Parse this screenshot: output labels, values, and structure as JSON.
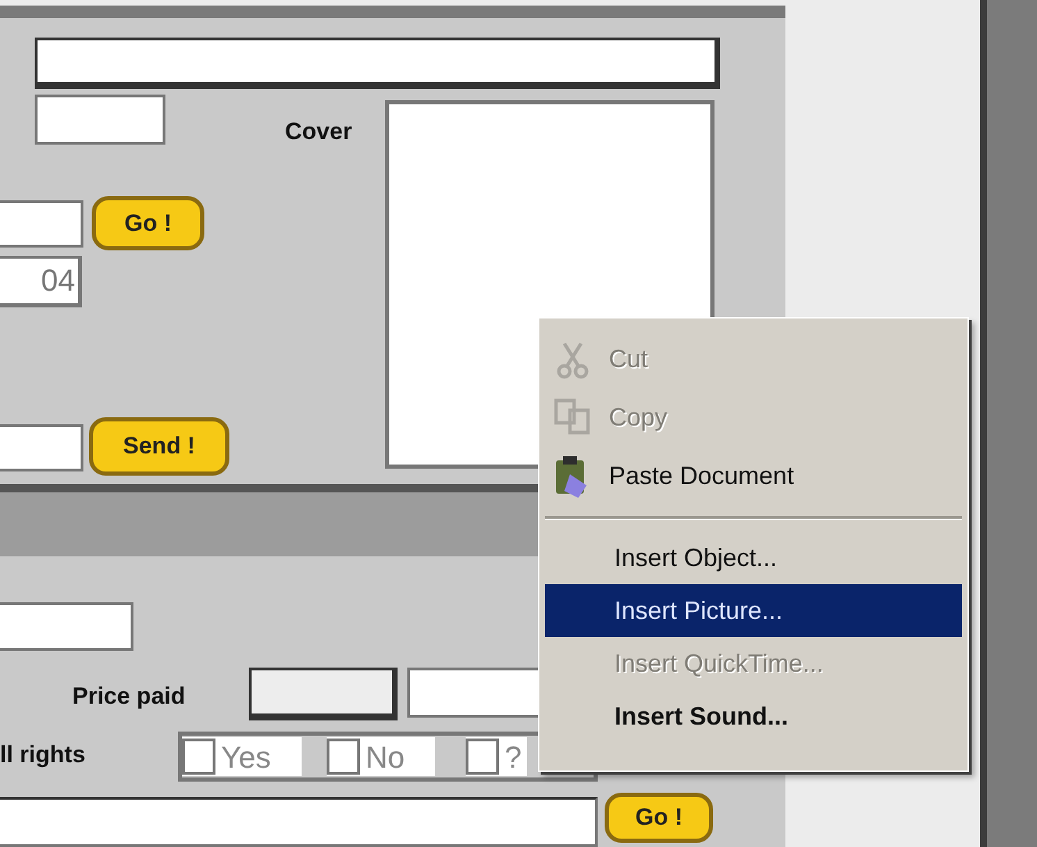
{
  "top_form": {
    "cover_label": "Cover",
    "go_button": "Go !",
    "number_field": {
      "value": "04"
    },
    "send_button": "Send !"
  },
  "bottom_form": {
    "price_label": "Price paid",
    "rights_label": "ll rights",
    "rights_options": [
      {
        "label": "Yes",
        "checked": false
      },
      {
        "label": "No",
        "checked": false
      },
      {
        "label": "?",
        "checked": false
      }
    ],
    "go_button": "Go !"
  },
  "context_menu": {
    "items": [
      {
        "kind": "icon_item",
        "label": "Cut",
        "disabled": true,
        "selected": false,
        "default": false
      },
      {
        "kind": "icon_item",
        "label": "Copy",
        "disabled": true,
        "selected": false,
        "default": false
      },
      {
        "kind": "icon_item",
        "label": "Paste Document",
        "disabled": false,
        "selected": false,
        "default": false
      },
      {
        "kind": "separator"
      },
      {
        "kind": "item",
        "label": "Insert Object...",
        "disabled": false,
        "selected": false,
        "default": false
      },
      {
        "kind": "item",
        "label": "Insert Picture...",
        "disabled": false,
        "selected": true,
        "default": false
      },
      {
        "kind": "item",
        "label": "Insert QuickTime...",
        "disabled": true,
        "selected": false,
        "default": false
      },
      {
        "kind": "item",
        "label": "Insert Sound...",
        "disabled": false,
        "selected": false,
        "default": true
      }
    ]
  }
}
